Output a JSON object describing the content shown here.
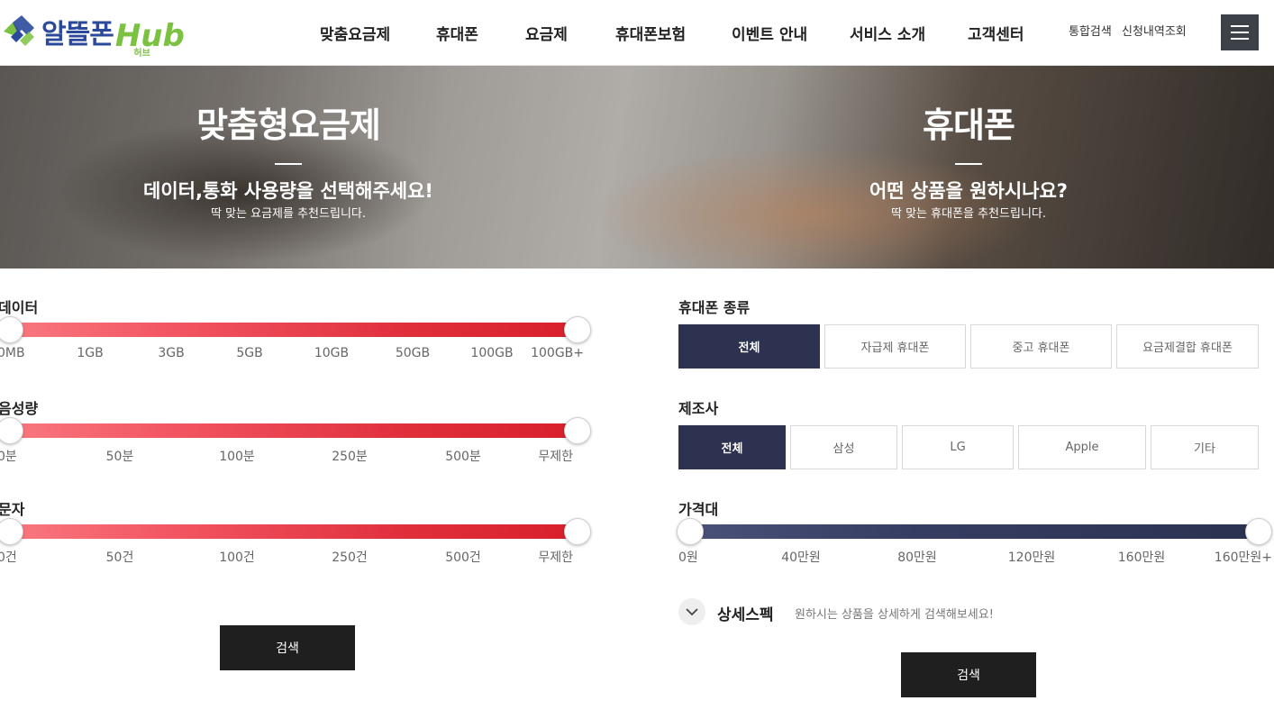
{
  "header": {
    "logo_text": "알뜰폰",
    "logo_hub": "Hub",
    "logo_sub": "허브",
    "nav": [
      "맞춤요금제",
      "휴대폰",
      "요금제",
      "휴대폰보험",
      "이벤트 안내",
      "서비스 소개",
      "고객센터"
    ],
    "util": [
      "통합검색",
      "신청내역조회"
    ]
  },
  "banner": {
    "left": {
      "title": "맞춤형요금제",
      "subtitle": "데이터,통화 사용량을 선택해주세요!",
      "desc": "딱 맞는 요금제를 추천드립니다."
    },
    "right": {
      "title": "휴대폰",
      "subtitle": "어떤 상품을 원하시나요?",
      "desc": "딱 맞는 휴대폰을 추천드립니다."
    }
  },
  "plan_filter": {
    "data": {
      "label": "데이터",
      "ticks": [
        "0MB",
        "1GB",
        "3GB",
        "5GB",
        "10GB",
        "50GB",
        "100GB",
        "100GB+"
      ]
    },
    "voice": {
      "label": "음성량",
      "ticks": [
        "0분",
        "50분",
        "100분",
        "250분",
        "500분",
        "무제한"
      ]
    },
    "sms": {
      "label": "문자",
      "ticks": [
        "0건",
        "50건",
        "100건",
        "250건",
        "500건",
        "무제한"
      ]
    },
    "search_label": "검색"
  },
  "phone_filter": {
    "type": {
      "label": "휴대폰 종류",
      "options": [
        "전체",
        "자급제 휴대폰",
        "중고 휴대폰",
        "요금제결합 휴대폰"
      ],
      "selected": "전체"
    },
    "maker": {
      "label": "제조사",
      "options": [
        "전체",
        "삼성",
        "LG",
        "Apple",
        "기타"
      ],
      "selected": "전체"
    },
    "price": {
      "label": "가격대",
      "ticks": [
        "0원",
        "40만원",
        "80만원",
        "120만원",
        "160만원",
        "160만원+"
      ]
    },
    "detail": {
      "title": "상세스펙",
      "desc": "원하시는 상품을 상세하게 검색해보세요!"
    },
    "search_label": "검색"
  },
  "colors": {
    "brand_blue": "#2b4a9b",
    "brand_green": "#7cc242",
    "accent_red": "#e02f3c",
    "navy": "#2d3250"
  }
}
